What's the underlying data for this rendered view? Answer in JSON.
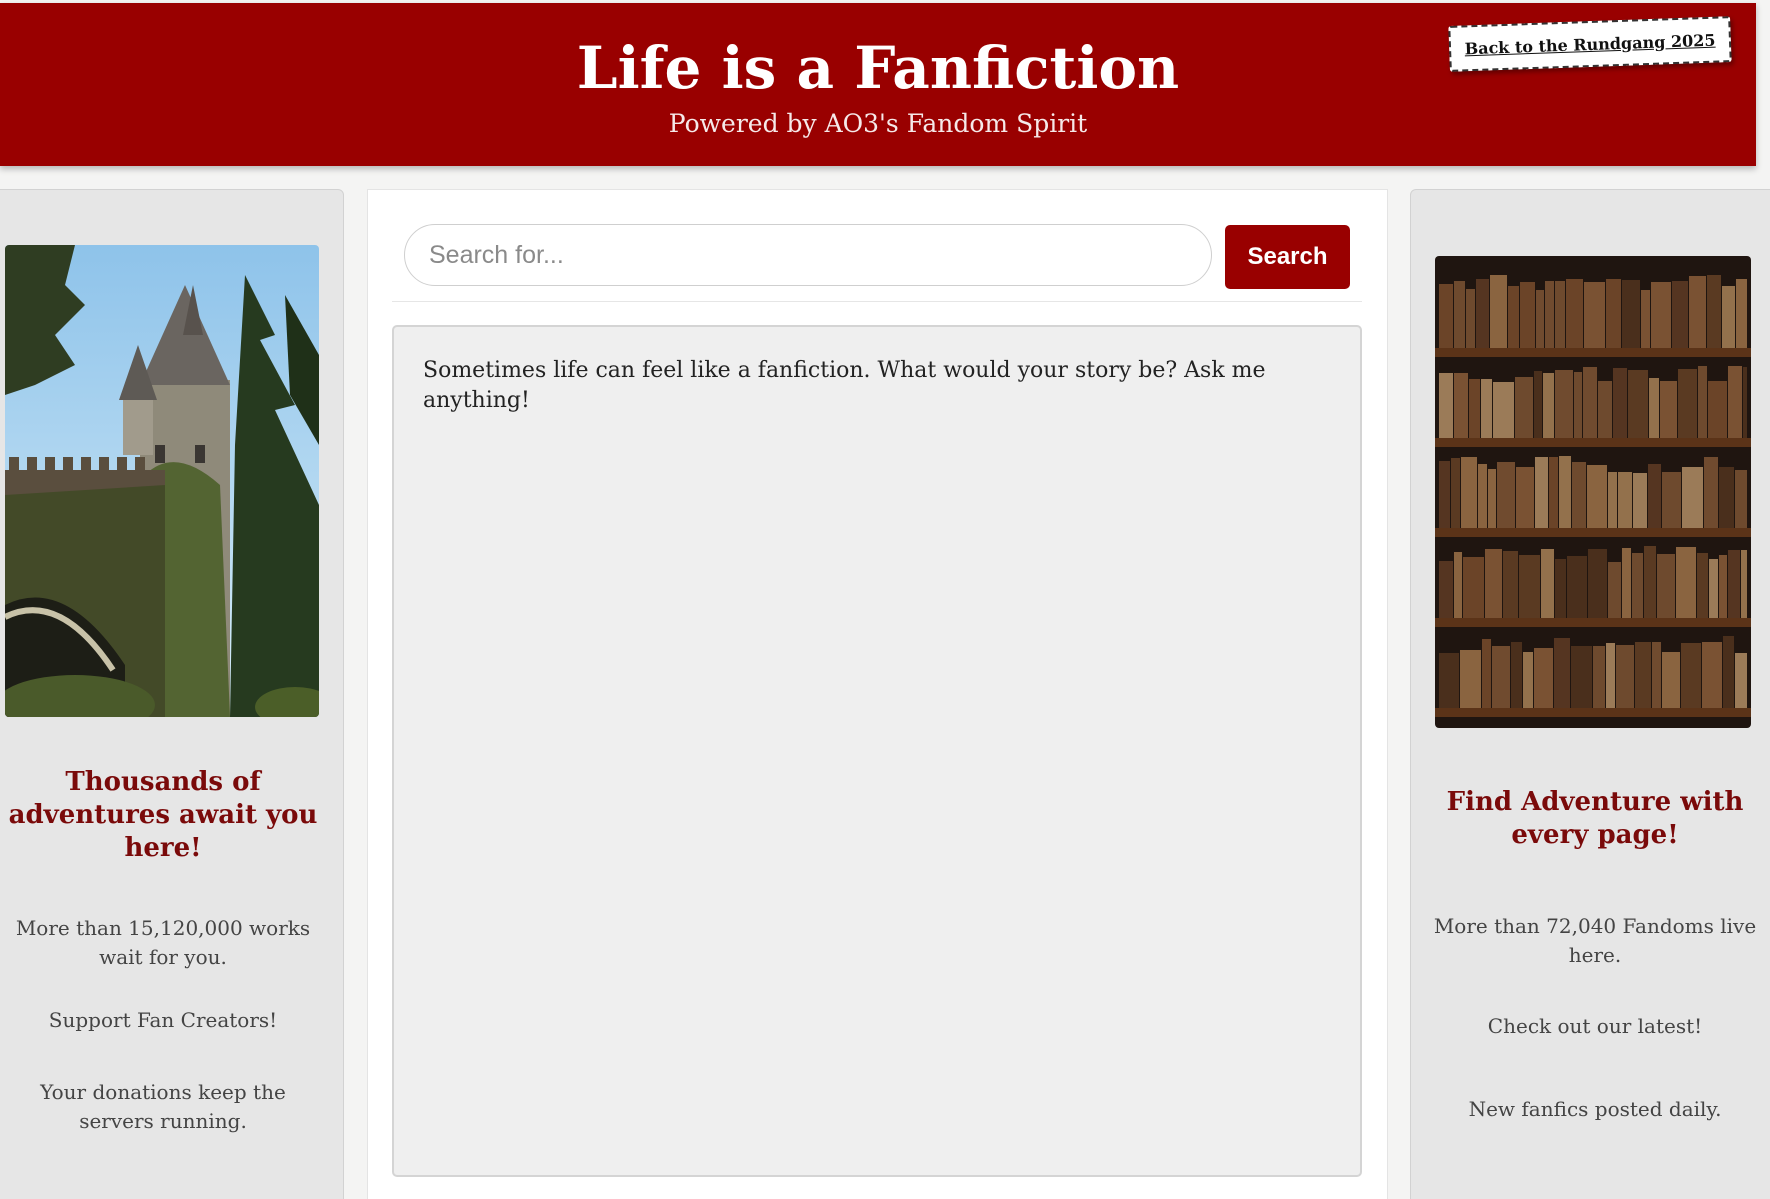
{
  "header": {
    "title": "Life is a Fanfiction",
    "subtitle": "Powered by AO3's Fandom Spirit",
    "back_link": "Back to the Rundgang 2025"
  },
  "left_panel": {
    "image": "castle-tower-image",
    "heading": "Thousands of adventures await you here!",
    "texts": [
      "More than 15,120,000 works wait for you.",
      "Support Fan Creators!",
      "Your donations keep the servers running."
    ]
  },
  "right_panel": {
    "image": "bookshelf-image",
    "heading": "Find Adventure with every page!",
    "texts": [
      "More than 72,040 Fandoms live here.",
      "Check out our latest!",
      "New fanfics posted daily."
    ]
  },
  "main": {
    "search_placeholder": "Search for...",
    "search_value": "",
    "search_button": "Search",
    "chat_message": "Sometimes life can feel like a fanfiction. What would your story be? Ask me anything!"
  },
  "colors": {
    "brand_red": "#990000",
    "heading_red": "#7a0a0a",
    "panel_gray": "#e6e6e6",
    "chat_bg": "#efefef"
  }
}
